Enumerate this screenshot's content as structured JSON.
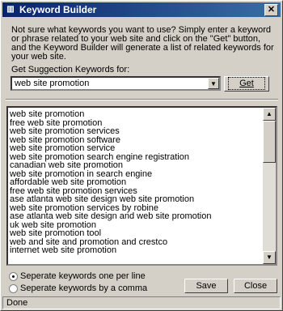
{
  "window": {
    "title": "Keyword Builder",
    "close_glyph": "✕",
    "app_icon": "book-icon"
  },
  "intro_text": "Not sure what keywords you want to use? Simply enter a keyword or phrase related to your web site and click on the \"Get\" button, and the Keyword Builder will generate a list of related keywords for your web site.",
  "suggest_label": "Get Suggection Keywords for:",
  "combo": {
    "value": "web site promotion",
    "arrow": "▼"
  },
  "get_button": "Get",
  "keywords": [
    "web site promotion",
    "free web site promotion",
    "web site promotion services",
    "web site promotion software",
    "web site promotion service",
    "web site promotion search engine registration",
    "canadian web site promotion",
    "web site promotion in search engine",
    "affordable web site promotion",
    "free web site promotion services",
    "ase atlanta web site design web site promotion",
    "web site promotion services by robine",
    "ase atlanta web site design and web site promotion",
    "uk web site promotion",
    "web site promotion tool",
    "web and site and promotion and crestco",
    "internet web site promotion"
  ],
  "scroll": {
    "up": "▲",
    "down": "▼"
  },
  "options": {
    "per_line": {
      "label": "Seperate keywords one per line",
      "selected": true
    },
    "comma": {
      "label": "Seperate keywords by a comma",
      "selected": false
    }
  },
  "save_button": "Save",
  "close_button": "Close",
  "status": "Done"
}
